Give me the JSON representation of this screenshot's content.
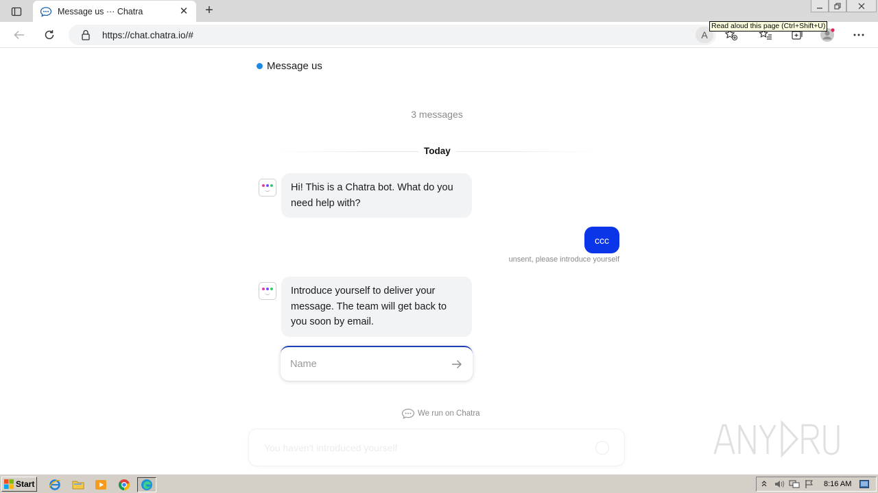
{
  "browser": {
    "tab_title": "Message us ··· Chatra",
    "url": "https://chat.chatra.io/#",
    "read_aloud_letter": "A",
    "tooltip": "Read aloud this page (Ctrl+Shift+U)",
    "new_tab_symbol": "+",
    "close_symbol": "✕"
  },
  "chat": {
    "title": "Message us",
    "message_count": "3 messages",
    "day_label": "Today",
    "messages": [
      {
        "from": "bot",
        "text": "Hi! This is a Chatra bot. What do you need help with?"
      },
      {
        "from": "user",
        "text": "ccc",
        "status": "unsent, please introduce yourself"
      },
      {
        "from": "bot",
        "text": "Introduce yourself to deliver your message. The team will get back to you soon by email."
      }
    ],
    "name_placeholder": "Name",
    "powered_by": "We run on Chatra",
    "composer_placeholder": "You haven't introduced yourself"
  },
  "taskbar": {
    "start_label": "Start",
    "clock": "8:16 AM"
  },
  "colors": {
    "accent": "#0a35e8",
    "status_dot": "#1e88e5",
    "bot_bubble": "#f1f3f5"
  }
}
